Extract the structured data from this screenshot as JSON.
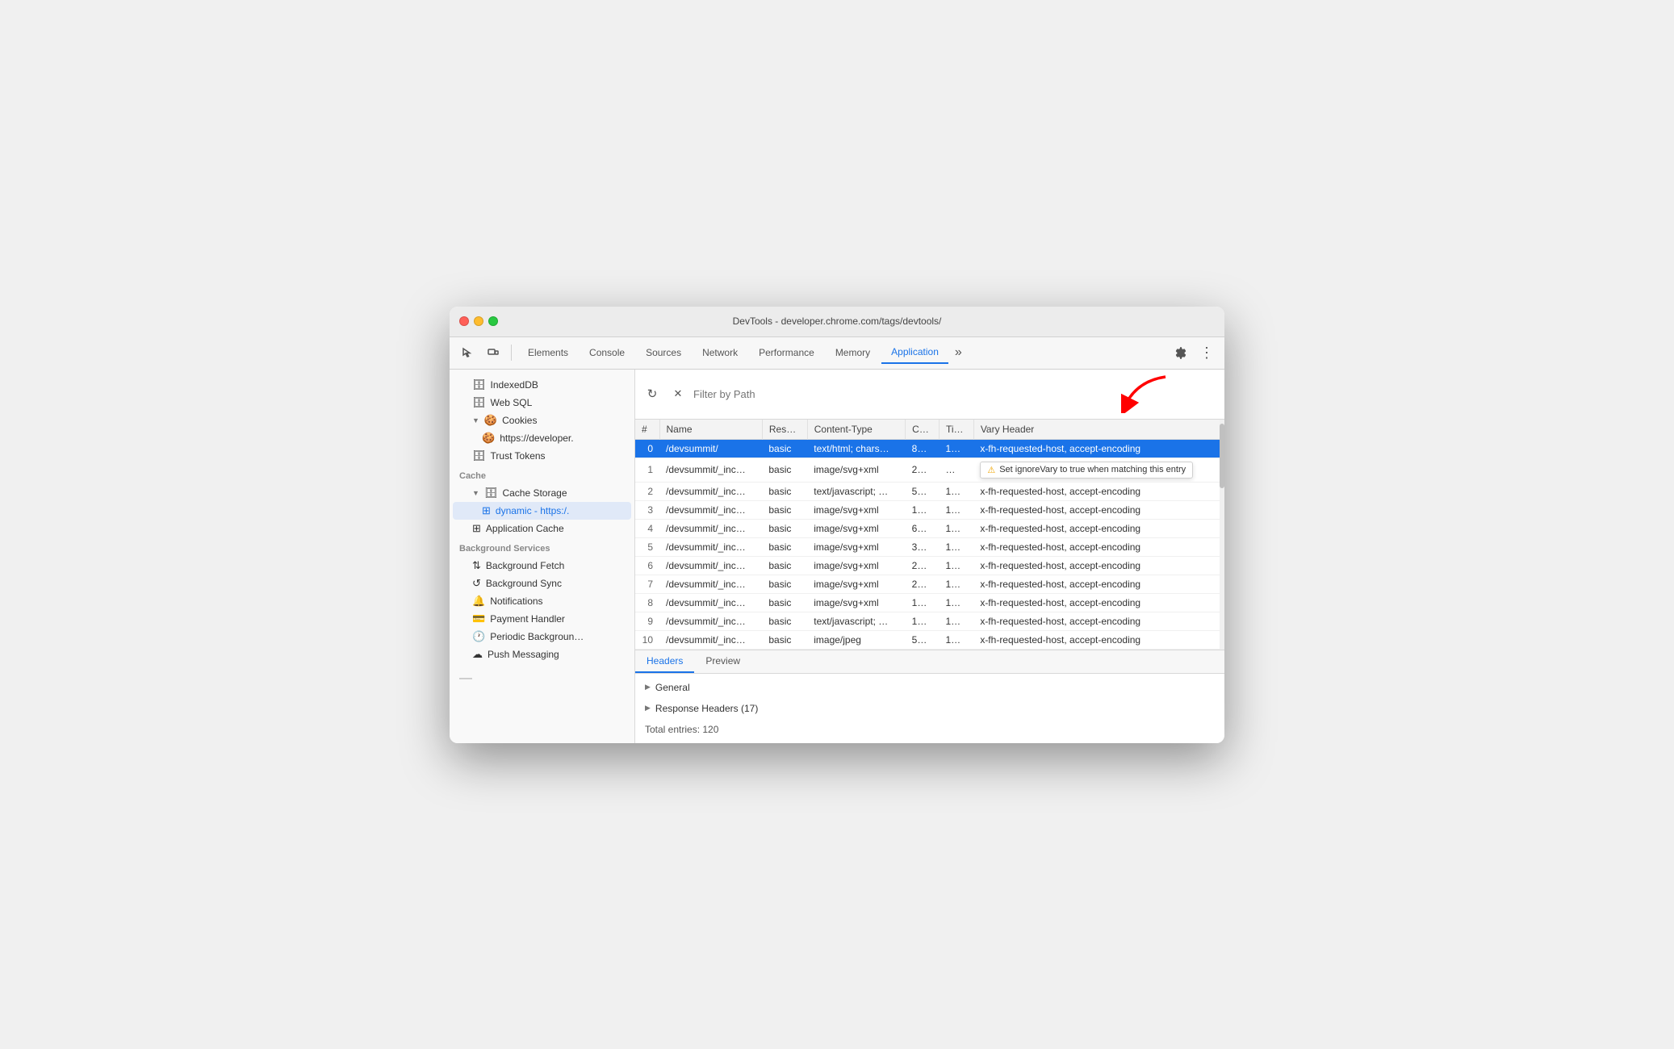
{
  "window": {
    "title": "DevTools - developer.chrome.com/tags/devtools/"
  },
  "toolbar": {
    "cursor_icon": "⬚",
    "tabs": [
      {
        "id": "elements",
        "label": "Elements",
        "active": false
      },
      {
        "id": "console",
        "label": "Console",
        "active": false
      },
      {
        "id": "sources",
        "label": "Sources",
        "active": false
      },
      {
        "id": "network",
        "label": "Network",
        "active": false
      },
      {
        "id": "performance",
        "label": "Performance",
        "active": false
      },
      {
        "id": "memory",
        "label": "Memory",
        "active": false
      },
      {
        "id": "application",
        "label": "Application",
        "active": true
      }
    ],
    "more_label": "»",
    "settings_icon": "⚙",
    "more_vert_icon": "⋮"
  },
  "sidebar": {
    "items": [
      {
        "id": "indexeddb",
        "label": "IndexedDB",
        "icon": "🗄",
        "indent": 1,
        "has_arrow": false
      },
      {
        "id": "websql",
        "label": "Web SQL",
        "icon": "🗄",
        "indent": 1,
        "has_arrow": false
      },
      {
        "id": "cookies",
        "label": "Cookies",
        "icon": "🍪",
        "indent": 1,
        "has_arrow": true,
        "expanded": true
      },
      {
        "id": "cookies-dev",
        "label": "https://developer.",
        "icon": "🍪",
        "indent": 2,
        "has_arrow": false
      },
      {
        "id": "trust-tokens",
        "label": "Trust Tokens",
        "icon": "🗄",
        "indent": 1,
        "has_arrow": false
      }
    ],
    "cache_section": "Cache",
    "cache_items": [
      {
        "id": "cache-storage",
        "label": "Cache Storage",
        "icon": "🗄",
        "indent": 1,
        "has_arrow": true,
        "expanded": true
      },
      {
        "id": "dynamic",
        "label": "dynamic - https:/.",
        "icon": "⊞",
        "indent": 2,
        "has_arrow": false,
        "active": true
      },
      {
        "id": "app-cache",
        "label": "Application Cache",
        "icon": "⊞",
        "indent": 1,
        "has_arrow": false
      }
    ],
    "bg_section": "Background Services",
    "bg_items": [
      {
        "id": "bg-fetch",
        "label": "Background Fetch",
        "icon": "⇅",
        "indent": 1
      },
      {
        "id": "bg-sync",
        "label": "Background Sync",
        "icon": "↺",
        "indent": 1
      },
      {
        "id": "notifications",
        "label": "Notifications",
        "icon": "🔔",
        "indent": 1
      },
      {
        "id": "payment-handler",
        "label": "Payment Handler",
        "icon": "💳",
        "indent": 1
      },
      {
        "id": "periodic-bg",
        "label": "Periodic Backgroun…",
        "icon": "🕐",
        "indent": 1
      },
      {
        "id": "push-messaging",
        "label": "Push Messaging",
        "icon": "☁",
        "indent": 1
      }
    ]
  },
  "filter": {
    "placeholder": "Filter by Path",
    "refresh_icon": "↻",
    "clear_icon": "✕"
  },
  "table": {
    "columns": [
      "#",
      "Name",
      "Res…",
      "Content-Type",
      "C…",
      "Ti…",
      "Vary Header"
    ],
    "rows": [
      {
        "num": "0",
        "name": "/devsummit/",
        "res": "basic",
        "content_type": "text/html; chars…",
        "c": "8…",
        "ti": "1…",
        "vary": "x-fh-requested-host, accept-encoding",
        "selected": true
      },
      {
        "num": "1",
        "name": "/devsummit/_inc…",
        "res": "basic",
        "content_type": "image/svg+xml",
        "c": "2…",
        "ti": "…",
        "vary": "",
        "tooltip": true
      },
      {
        "num": "2",
        "name": "/devsummit/_inc…",
        "res": "basic",
        "content_type": "text/javascript; …",
        "c": "5…",
        "ti": "1…",
        "vary": "x-fh-requested-host, accept-encoding"
      },
      {
        "num": "3",
        "name": "/devsummit/_inc…",
        "res": "basic",
        "content_type": "image/svg+xml",
        "c": "1…",
        "ti": "1…",
        "vary": "x-fh-requested-host, accept-encoding"
      },
      {
        "num": "4",
        "name": "/devsummit/_inc…",
        "res": "basic",
        "content_type": "image/svg+xml",
        "c": "6…",
        "ti": "1…",
        "vary": "x-fh-requested-host, accept-encoding"
      },
      {
        "num": "5",
        "name": "/devsummit/_inc…",
        "res": "basic",
        "content_type": "image/svg+xml",
        "c": "3…",
        "ti": "1…",
        "vary": "x-fh-requested-host, accept-encoding"
      },
      {
        "num": "6",
        "name": "/devsummit/_inc…",
        "res": "basic",
        "content_type": "image/svg+xml",
        "c": "2…",
        "ti": "1…",
        "vary": "x-fh-requested-host, accept-encoding"
      },
      {
        "num": "7",
        "name": "/devsummit/_inc…",
        "res": "basic",
        "content_type": "image/svg+xml",
        "c": "2…",
        "ti": "1…",
        "vary": "x-fh-requested-host, accept-encoding"
      },
      {
        "num": "8",
        "name": "/devsummit/_inc…",
        "res": "basic",
        "content_type": "image/svg+xml",
        "c": "1…",
        "ti": "1…",
        "vary": "x-fh-requested-host, accept-encoding"
      },
      {
        "num": "9",
        "name": "/devsummit/_inc…",
        "res": "basic",
        "content_type": "text/javascript; …",
        "c": "1…",
        "ti": "1…",
        "vary": "x-fh-requested-host, accept-encoding"
      },
      {
        "num": "10",
        "name": "/devsummit/_inc…",
        "res": "basic",
        "content_type": "image/jpeg",
        "c": "5…",
        "ti": "1…",
        "vary": "x-fh-requested-host, accept-encoding"
      }
    ],
    "tooltip_text": "Set ignoreVary to true when matching this entry"
  },
  "bottom": {
    "tabs": [
      {
        "id": "headers",
        "label": "Headers",
        "active": true
      },
      {
        "id": "preview",
        "label": "Preview",
        "active": false
      }
    ],
    "sections": [
      {
        "id": "general",
        "label": "General"
      },
      {
        "id": "response-headers",
        "label": "Response Headers (17)"
      }
    ],
    "total_entries": "Total entries: 120"
  }
}
